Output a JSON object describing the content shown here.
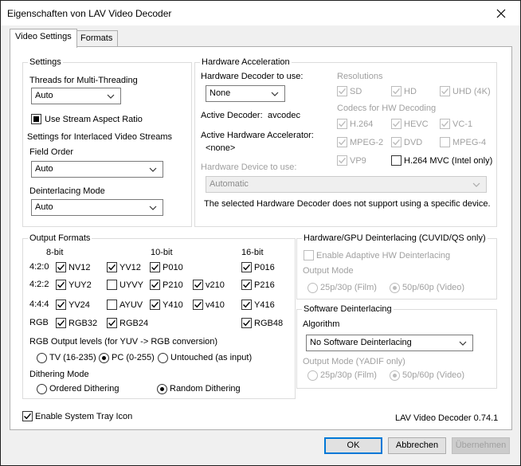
{
  "window": {
    "title": "Eigenschaften von LAV Video Decoder"
  },
  "tabs": [
    "Video Settings",
    "Formats"
  ],
  "settings": {
    "group_title": "Settings",
    "threads_label": "Threads for Multi-Threading",
    "threads_value": "Auto",
    "stream_aspect_label": "Use Stream Aspect Ratio",
    "interlaced_label": "Settings for Interlaced Video Streams",
    "field_order_label": "Field Order",
    "field_order_value": "Auto",
    "deint_mode_label": "Deinterlacing Mode",
    "deint_mode_value": "Auto"
  },
  "hwaccel": {
    "group_title": "Hardware Acceleration",
    "decoder_label": "Hardware Decoder to use:",
    "decoder_value": "None",
    "active_decoder_label": "Active Decoder:",
    "active_decoder_value": "avcodec",
    "active_accel_label": "Active Hardware Accelerator:",
    "active_accel_value": "<none>",
    "device_label": "Hardware Device to use:",
    "device_value": "Automatic",
    "device_note": "The selected Hardware Decoder does not support using a specific device.",
    "resolutions_label": "Resolutions",
    "resolutions": [
      "SD",
      "HD",
      "UHD (4K)"
    ],
    "codecs_label": "Codecs for HW Decoding",
    "codecs": [
      "H.264",
      "HEVC",
      "VC-1",
      "MPEG-2",
      "DVD",
      "MPEG-4",
      "VP9",
      "H.264 MVC (Intel only)"
    ]
  },
  "output_formats": {
    "group_title": "Output Formats",
    "col_headers": [
      "8-bit",
      "10-bit",
      "16-bit"
    ],
    "row_labels": [
      "4:2:0",
      "4:2:2",
      "4:4:4",
      "RGB"
    ],
    "formats": [
      "NV12",
      "YV12",
      "P010",
      "P016",
      "YUY2",
      "UYVY",
      "P210",
      "v210",
      "P216",
      "YV24",
      "AYUV",
      "Y410",
      "v410",
      "Y416",
      "RGB32",
      "RGB24",
      "RGB48"
    ],
    "rgb_levels_label": "RGB Output levels (for YUV -> RGB conversion)",
    "rgb_levels": [
      "TV (16-235)",
      "PC (0-255)",
      "Untouched (as input)"
    ],
    "dither_label": "Dithering Mode",
    "dither_options": [
      "Ordered Dithering",
      "Random Dithering"
    ]
  },
  "hw_deint": {
    "group_title": "Hardware/GPU Deinterlacing (CUVID/QS only)",
    "enable_label": "Enable Adaptive HW Deinterlacing",
    "output_mode_label": "Output Mode",
    "mode_options": [
      "25p/30p (Film)",
      "50p/60p (Video)"
    ]
  },
  "sw_deint": {
    "group_title": "Software Deinterlacing",
    "algorithm_label": "Algorithm",
    "algorithm_value": "No Software Deinterlacing",
    "output_mode_label": "Output Mode (YADIF only)",
    "mode_options": [
      "25p/30p (Film)",
      "50p/60p (Video)"
    ]
  },
  "footer": {
    "tray_label": "Enable System Tray Icon",
    "version": "LAV Video Decoder 0.74.1"
  },
  "buttons": {
    "ok": "OK",
    "cancel": "Abbrechen",
    "apply": "Übernehmen"
  },
  "colors": {
    "accent": "#0078d7",
    "disabled_text": "#a0a0a0"
  }
}
